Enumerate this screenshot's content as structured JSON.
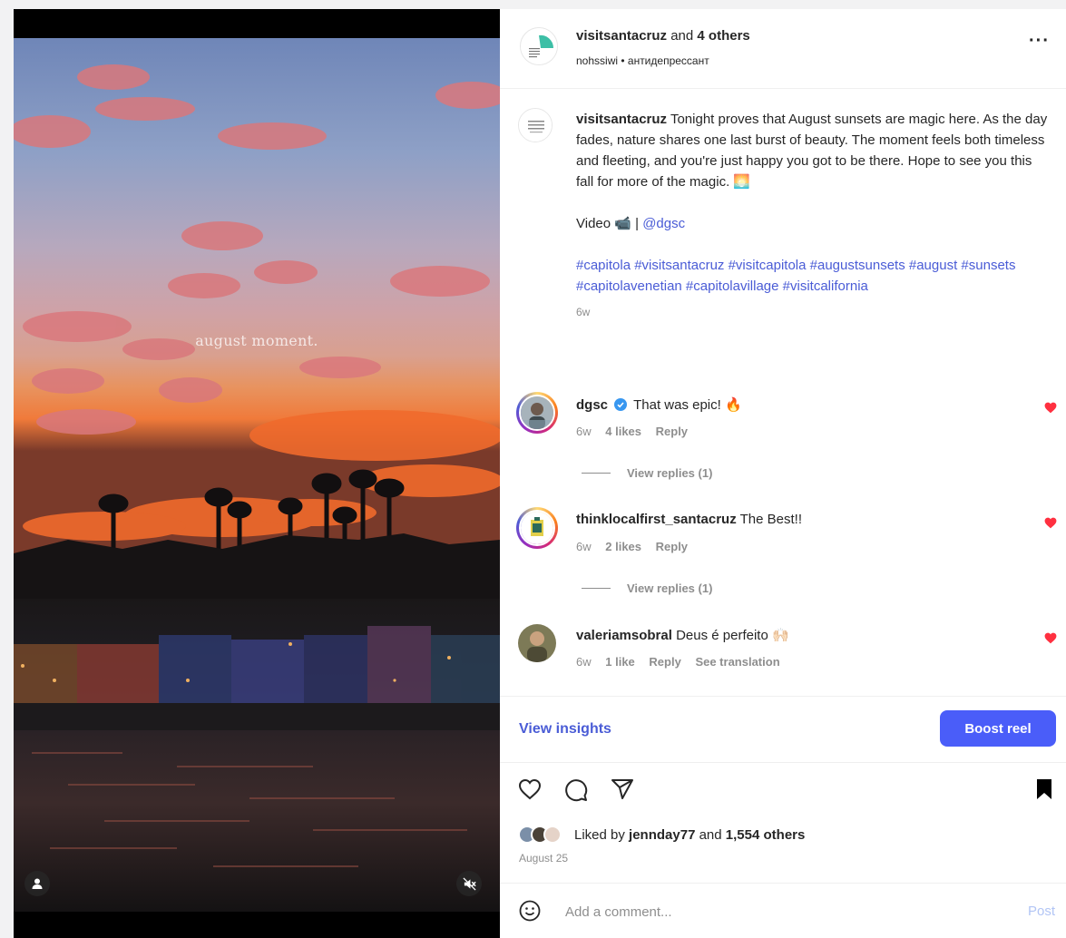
{
  "post": {
    "overlay_text": "august moment.",
    "header": {
      "author": "visitsantacruz",
      "and_text": "and",
      "others": "4 others",
      "subline": "nohssiwi • антидепрессант",
      "more_icon": "more-horizontal-icon"
    },
    "caption": {
      "username": "visitsantacruz",
      "text": "Tonight proves that August sunsets are magic here. As the day fades, nature shares one last burst of beauty. The moment feels both timeless and fleeting, and you're just happy you got to be there. Hope to see you this fall for more of the magic. 🌅",
      "video_label": "Video 📹 |",
      "video_credit": "@dgsc",
      "hashtags": "#capitola #visitsantacruz #visitcapitola #augustsunsets #august #sunsets #capitolavenetian #capitolavillage #visitcalifornia",
      "age": "6w"
    },
    "comments": [
      {
        "username": "dgsc",
        "verified": true,
        "text": "That was epic! 🔥",
        "age": "6w",
        "likes": "4 likes",
        "reply": "Reply",
        "view_replies": "View replies (1)"
      },
      {
        "username": "thinklocalfirst_santacruz",
        "verified": false,
        "text": "The Best!!",
        "age": "6w",
        "likes": "2 likes",
        "reply": "Reply",
        "view_replies": "View replies (1)"
      },
      {
        "username": "valeriamsobral",
        "verified": false,
        "text": "Deus é perfeito 🙌🏻",
        "age": "6w",
        "likes": "1 like",
        "reply": "Reply",
        "translation": "See translation"
      }
    ],
    "insights": {
      "link": "View insights",
      "boost": "Boost reel"
    },
    "likes": {
      "prefix": "Liked by",
      "user": "jennday77",
      "and_text": "and",
      "count": "1,554 others"
    },
    "date": "August 25",
    "comment_box": {
      "placeholder": "Add a comment...",
      "post_label": "Post"
    },
    "colors": {
      "accent": "#4a5cd6",
      "boost": "#4a5df9",
      "heart": "#ff3040"
    }
  }
}
